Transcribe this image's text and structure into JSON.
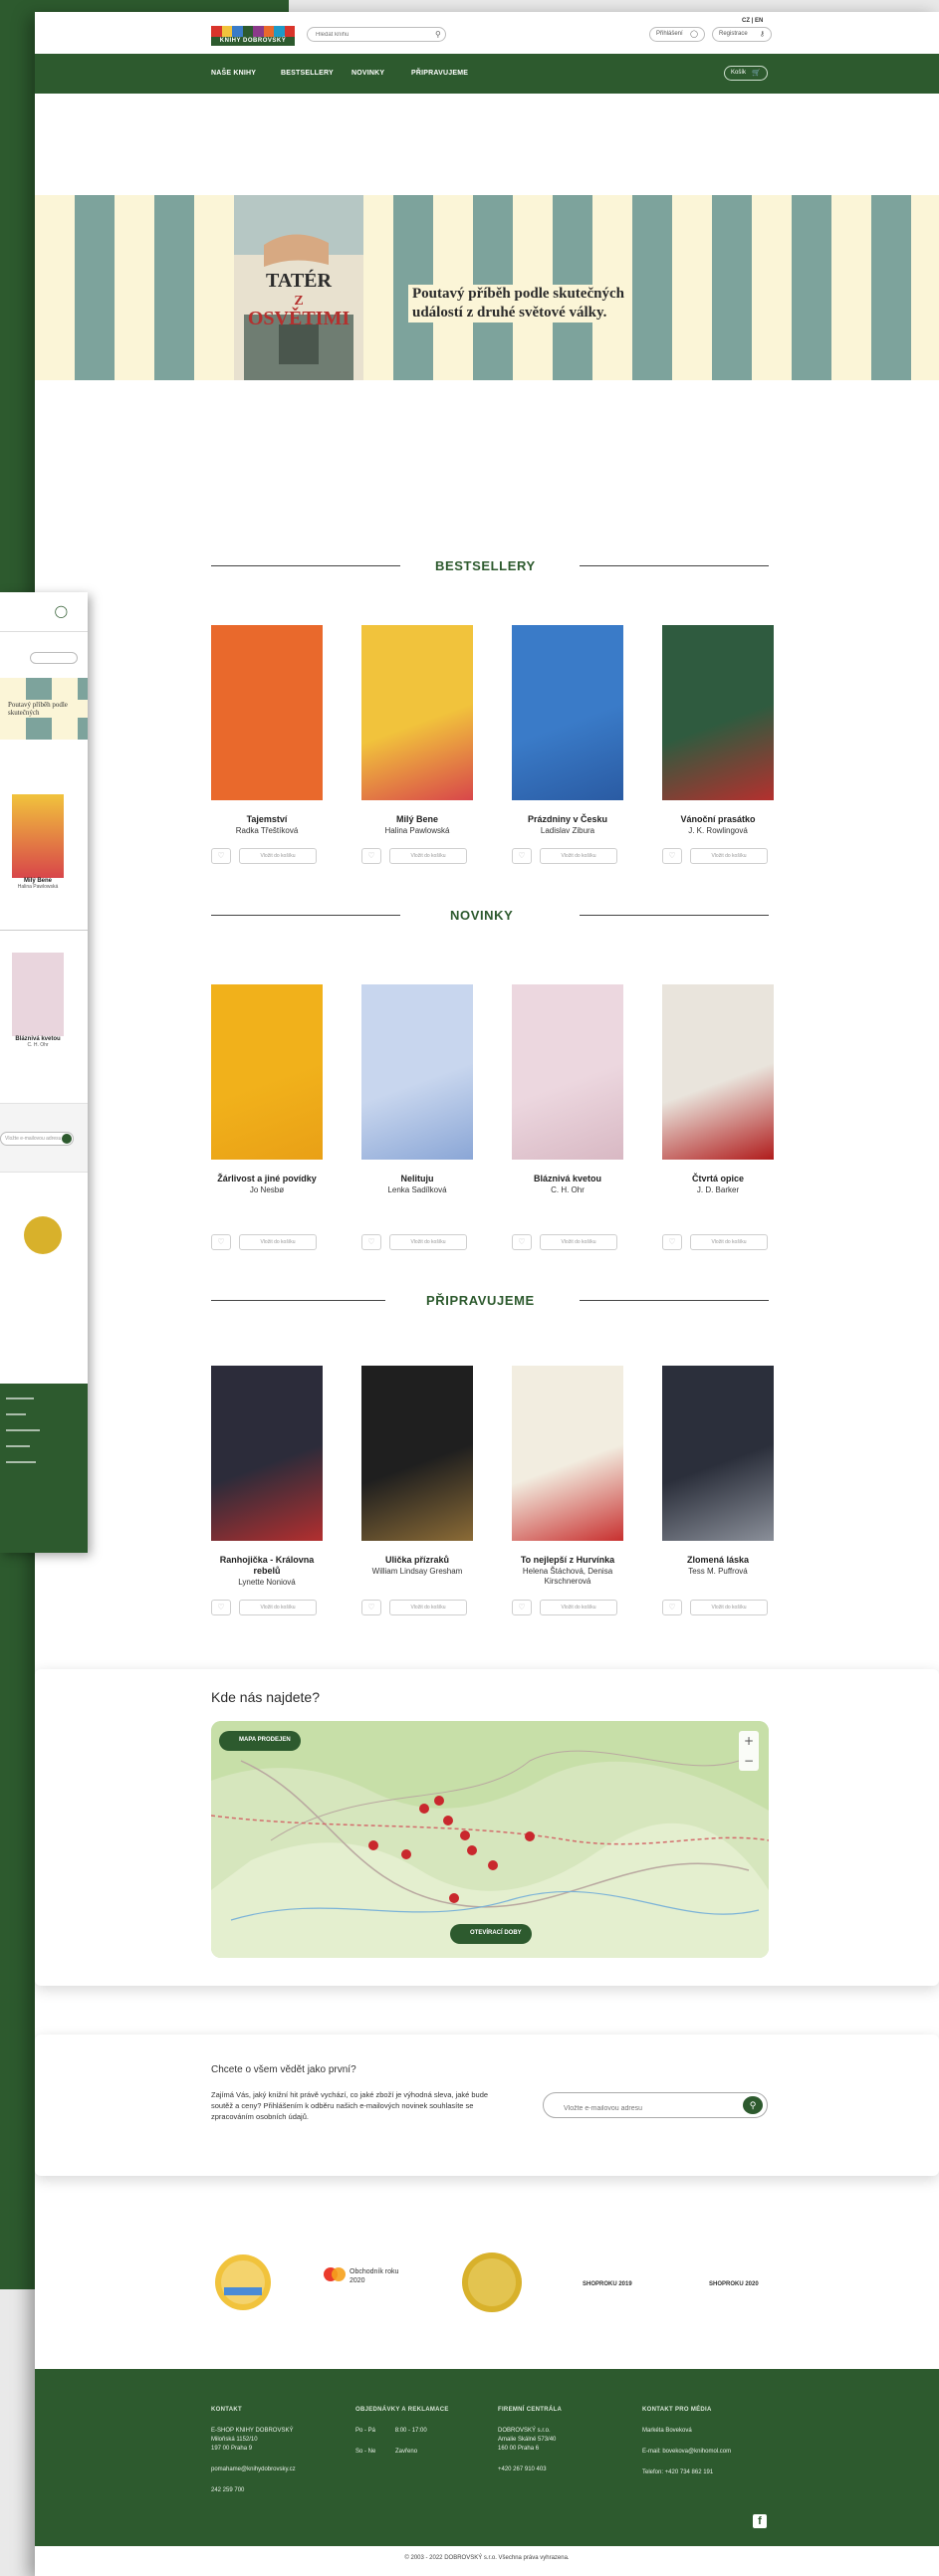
{
  "header": {
    "logo": "KNIHY DOBROVSKÝ",
    "search_placeholder": "Hledat knihu",
    "lang": "CZ | EN",
    "login": "Přihlášení",
    "register": "Registrace",
    "cart": "Košík"
  },
  "nav": [
    "NAŠE KNIHY",
    "BESTSELLERY",
    "NOVINKY",
    "PŘIPRAVUJEME"
  ],
  "banner": {
    "book_cover_lines": [
      "TATÉR",
      "Z",
      "OSVĚTIMI"
    ],
    "headline_1": "Poutavý příběh podle skutečných",
    "headline_2": "událostí z druhé světové války."
  },
  "sections": [
    {
      "title": "BESTSELLERY",
      "books": [
        {
          "title": "Tajemství",
          "author": "Radka Třeštíková",
          "cover_colors": [
            "#e9692c",
            "#e9692c"
          ]
        },
        {
          "title": "Milý Bene",
          "author": "Halina Pawlowská",
          "cover_colors": [
            "#f1c33c",
            "#d8464a"
          ]
        },
        {
          "title": "Prázdniny v Česku",
          "author": "Ladislav Zibura",
          "cover_colors": [
            "#3a7bc8",
            "#2a5ba3"
          ]
        },
        {
          "title": "Vánoční prasátko",
          "author": "J. K. Rowlingová",
          "cover_colors": [
            "#2f5b3f",
            "#b5302e"
          ]
        }
      ]
    },
    {
      "title": "NOVINKY",
      "books": [
        {
          "title": "Žárlivost a jiné povídky",
          "author": "Jo Nesbø",
          "cover_colors": [
            "#f1b11b",
            "#e9a016"
          ]
        },
        {
          "title": "Nelituju",
          "author": "Lenka Sadílková",
          "cover_colors": [
            "#c8d6ee",
            "#8aa6d6"
          ]
        },
        {
          "title": "Bláznivá kvetou",
          "author": "C. H. Ohr",
          "cover_colors": [
            "#ecd7df",
            "#d8b8c3"
          ]
        },
        {
          "title": "Čtvrtá opice",
          "author": "J. D. Barker",
          "cover_colors": [
            "#e9e4dc",
            "#b01c1c"
          ]
        }
      ]
    },
    {
      "title": "PŘIPRAVUJEME",
      "books": [
        {
          "title": "Ranhojička - Královna rebelů",
          "author": "Lynette Noniová",
          "cover_colors": [
            "#2c2c3a",
            "#b32f2f"
          ]
        },
        {
          "title": "Ulička přízraků",
          "author": "William Lindsay Gresham",
          "cover_colors": [
            "#1f1f1f",
            "#8b6b36"
          ]
        },
        {
          "title": "To nejlepší z Hurvínka",
          "author": "Helena Štáchová, Denisa Kirschnerová",
          "cover_colors": [
            "#f2ede0",
            "#c8302f"
          ]
        },
        {
          "title": "Zlomená láska",
          "author": "Tess M. Puffrová",
          "cover_colors": [
            "#2b2f3b",
            "#8a8f99"
          ]
        }
      ]
    }
  ],
  "book_actions": {
    "buy": "Vložit do košíku"
  },
  "map": {
    "title": "Kde nás najdete?",
    "btn_prodejny": "MAPA PRODEJEN",
    "btn_oteviraci": "OTEVÍRACÍ DOBY"
  },
  "newsletter": {
    "title": "Chcete o všem vědět jako první?",
    "text": "Zajímá Vás, jaký knižní hit právě vychází, co jaké zboží je výhodná sleva, jaké bude soutěž a ceny? Přihlášením k odběru našich e-mailových novinek souhlasíte se zpracováním osobních údajů.",
    "placeholder": "Vložte e-mailovou adresu"
  },
  "badges": {
    "mastercard": "Obchodník roku 2020",
    "shoproku1": "SHOPROKU 2019",
    "shoproku2": "SHOPROKU 2020"
  },
  "footer": {
    "col1_title": "KONTAKT",
    "col1_lines": [
      "E-SHOP KNIHY DOBROVSKÝ",
      "Miloňská 1152/10",
      "197 00 Praha 9"
    ],
    "col1_email": "pomahame@knihydobrovsky.cz",
    "col1_phone": "242 259 700",
    "col2_title": "OBJEDNÁVKY A REKLAMACE",
    "col2_row1_a": "Po - Pá",
    "col2_row1_b": "8:00 - 17:00",
    "col2_row2_a": "So - Ne",
    "col2_row2_b": "Zavřeno",
    "col3_title": "FIREMNÍ CENTRÁLA",
    "col3_lines": [
      "DOBROVSKÝ s.r.o.",
      "Amalie Skálné 573/40",
      "160 00 Praha 6"
    ],
    "col3_phone": "+420 267 910 403",
    "col4_title": "KONTAKT PRO MÉDIA",
    "col4_name": "Markéta Boveková",
    "col4_email": "E-mail: bovekova@knihomol.com",
    "col4_phone": "Telefon: +420 734 862 191"
  },
  "copyright": "© 2003 - 2022 DOBROVSKÝ s.r.o. Všechna práva vyhrazena."
}
